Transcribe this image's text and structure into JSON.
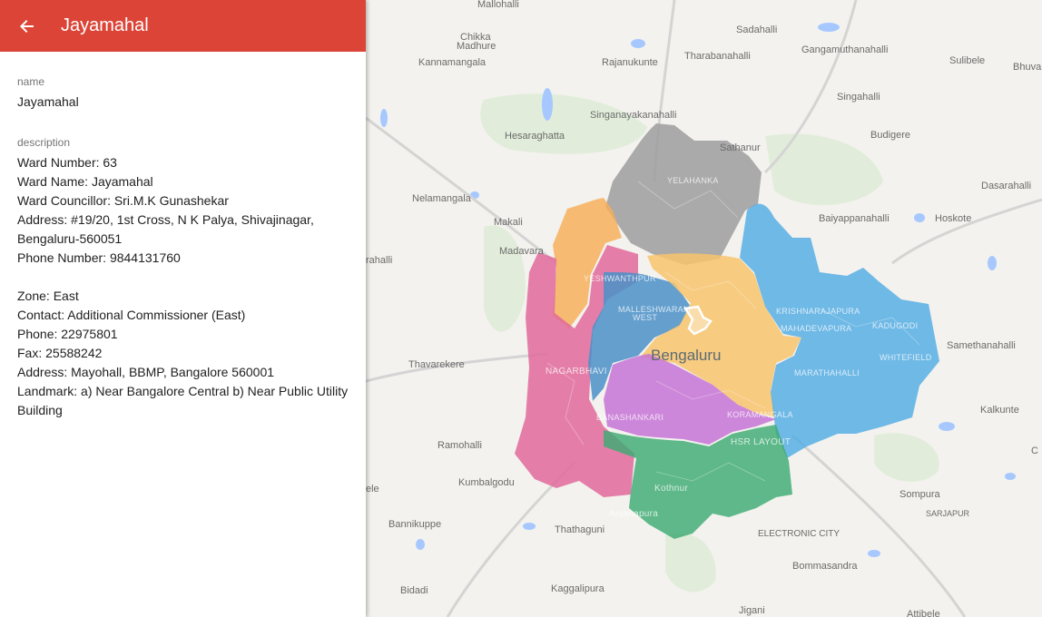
{
  "panel": {
    "title": "Jayamahal",
    "name_label": "name",
    "name_value": "Jayamahal",
    "description_label": "description",
    "description_lines": [
      "Ward Number: 63",
      "Ward Name: Jayamahal",
      "Ward Councillor: Sri.M.K Gunashekar",
      "Address: #19/20, 1st Cross, N K Palya, Shivajinagar,",
      "Bengaluru-560051",
      "Phone Number: 9844131760",
      "",
      "Zone: East",
      "Contact: Additional Commissioner (East)",
      "Phone: 22975801",
      "Fax: 25588242",
      "Address: Mayohall, BBMP, Bangalore 560001",
      "Landmark: a) Near Bangalore Central b) Near Public Utility",
      "Building"
    ]
  },
  "map": {
    "city_label": "Bengaluru",
    "places": {
      "mallohalli": "Mallohalli",
      "chikka": "Chikka",
      "madhure": "Madhure",
      "sadahalli": "Sadahalli",
      "gangamuthanahalli": "Gangamuthanahalli",
      "kannamangala": "Kannamangala",
      "rajanukunte": "Rajanukunte",
      "tharabanahalli": "Tharabanahalli",
      "sulibele": "Sulibele",
      "bhuva": "Bhuva",
      "singahalli": "Singahalli",
      "singanayakanahalli": "Singanayakanahalli",
      "hesaraghatta": "Hesaraghatta",
      "sathanur": "Sathanur",
      "budigere": "Budigere",
      "dasarahalli": "Dasarahalli",
      "nelamangala": "Nelamangala",
      "makali": "Makali",
      "baiyappanahalli": "Baiyappanahalli",
      "hoskote": "Hoskote",
      "madavara": "Madavara",
      "rahalli": "rahalli",
      "samethanahalli": "Samethanahalli",
      "thavarekere": "Thavarekere",
      "kalkunte": "Kalkunte",
      "ramohalli": "Ramohalli",
      "kumbalgodu": "Kumbalgodu",
      "ele": "ele",
      "sompura": "Sompura",
      "sarjapur": "SARJAPUR",
      "bannikuppe": "Bannikuppe",
      "thathaguni": "Thathaguni",
      "electronic_city": "ELECTRONIC CITY",
      "bommasandra": "Bommasandra",
      "bidadi": "Bidadi",
      "kaggalipura": "Kaggalipura",
      "jigani": "Jigani",
      "attibele": "Attibele",
      "c": "C"
    },
    "areas": {
      "yelahanka": "YELAHANKA",
      "yeshwanthpur": "YESHWANTHPUR",
      "malleshwaram": "MALLESHWARAM",
      "west": "WEST",
      "krishnarajapura": "KRISHNARAJAPURA",
      "mahadevapura": "MAHADEVAPURA",
      "kadugodi": "KADUGODI",
      "whitefield": "WHITEFIELD",
      "marathahalli": "MARATHAHALLI",
      "nagarbhavi": "NAGARBHAVI",
      "banashankari": "BANASHANKARI",
      "koramangala": "KORAMANGALA",
      "hsr_layout": "HSR LAYOUT",
      "kothnur": "Kothnur",
      "anjanapura": "Anjanapura"
    },
    "zone_colors": {
      "yelahanka": "#9e9e9e",
      "dasarahalli": "#f6ad58",
      "west": "#e06a9b",
      "rr_nagar": "#e0649a",
      "west_inner": "#4a90c8",
      "east": "#f7c46c",
      "mahadevapura": "#52ace4",
      "south": "#c674d6",
      "bommanahalli": "#3dab73"
    }
  }
}
